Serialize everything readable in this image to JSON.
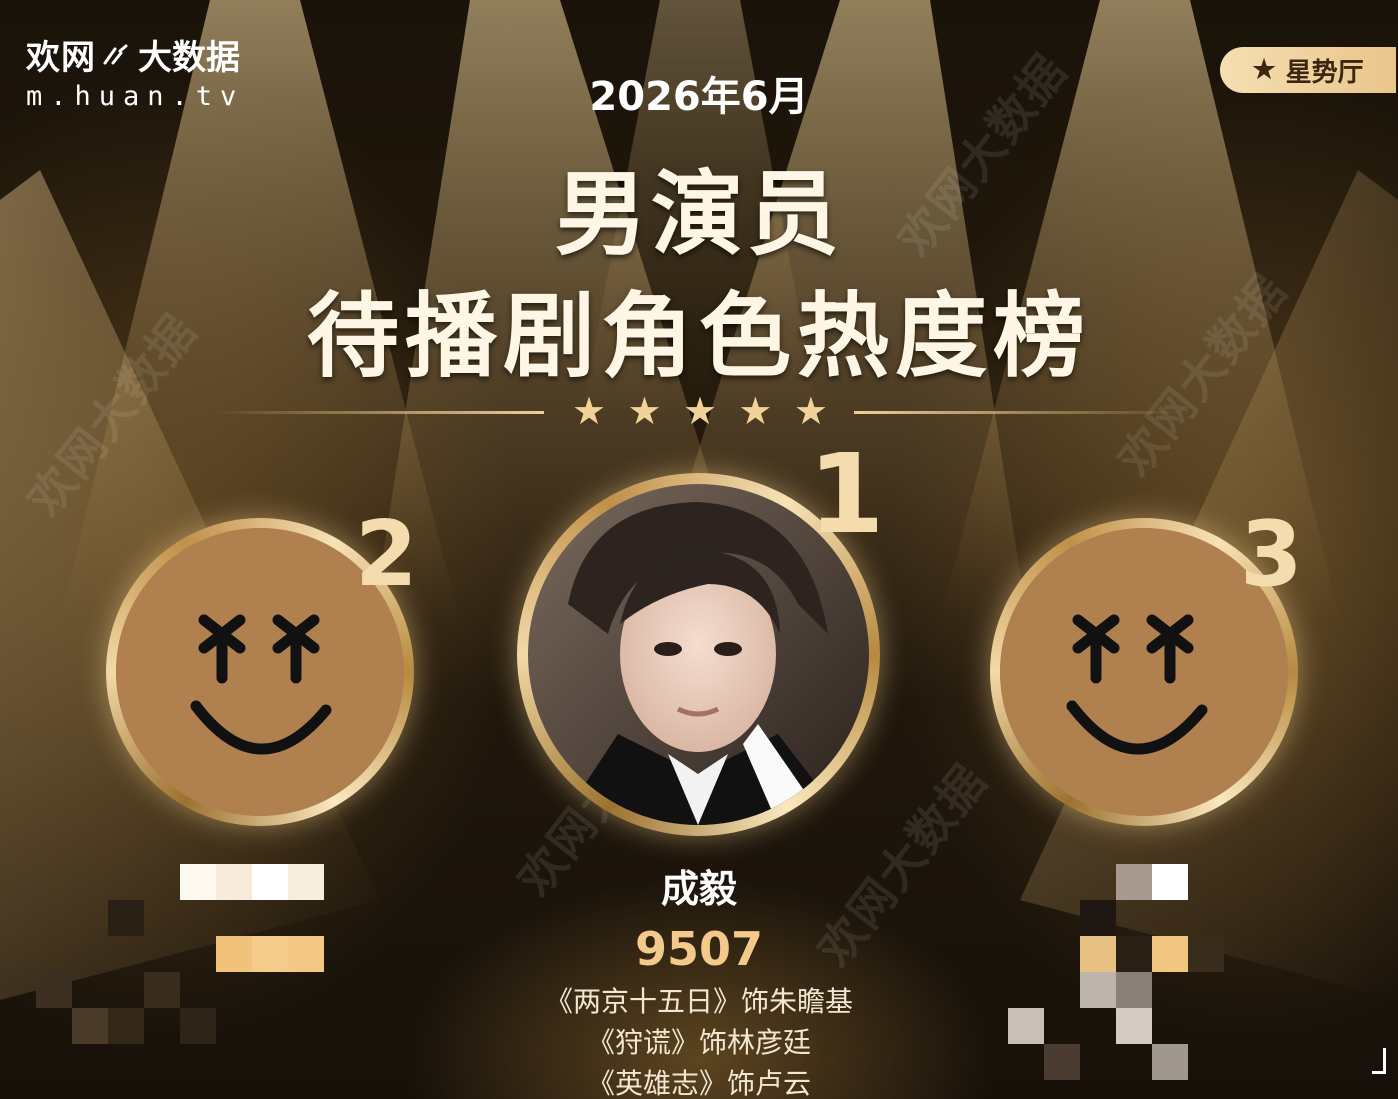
{
  "logo": {
    "brand": "欢网",
    "product": "大数据",
    "url": "m.huan.tv"
  },
  "badge": {
    "icon": "star-icon",
    "label": "星势厅"
  },
  "header": {
    "date": "2026年6月",
    "title_line1": "男演员",
    "title_line2": "待播剧角色热度榜",
    "stars": [
      "★",
      "★",
      "★",
      "★",
      "★"
    ]
  },
  "watermark_text": "欢网大数据",
  "ranking": {
    "first": {
      "rank": "1",
      "name": "成毅",
      "score": "9507",
      "roles": [
        "《两京十五日》饰朱瞻基",
        "《狩谎》饰林彦廷",
        "《英雄志》饰卢云"
      ]
    },
    "second": {
      "rank": "2",
      "avatar": "smiley-face-icon"
    },
    "third": {
      "rank": "3",
      "avatar": "smiley-face-icon"
    }
  },
  "colors": {
    "gold": "#f3d29a",
    "score": "#f3c98c",
    "placeholder_avatar": "#b0804e"
  }
}
